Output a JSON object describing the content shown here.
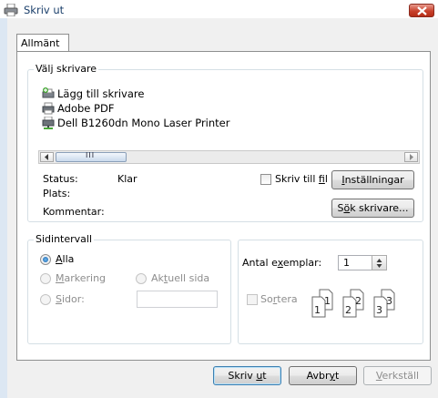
{
  "window": {
    "title": "Skriv ut",
    "close": "×"
  },
  "tabs": [
    {
      "label": "Allmänt"
    }
  ],
  "printer_group": {
    "legend": "Välj skrivare",
    "printers": [
      {
        "label": "Lägg till skrivare",
        "icon": "add-printer-icon"
      },
      {
        "label": "Adobe PDF",
        "icon": "printer-icon"
      },
      {
        "label": "Dell B1260dn Mono Laser Printer",
        "icon": "network-printer-icon"
      }
    ],
    "scroll_thumb": "III",
    "status_label": "Status:",
    "status_value": "Klar",
    "location_label": "Plats:",
    "comment_label": "Kommentar:",
    "print_to_file": {
      "pre": "Skriv till ",
      "acc": "f",
      "post": "il"
    },
    "settings_button": {
      "acc": "I",
      "post": "nställningar"
    },
    "find_printer_button": {
      "pre": "S",
      "acc": "ö",
      "post": "k skrivare..."
    }
  },
  "range_group": {
    "legend": "Sidintervall",
    "all": {
      "acc": "A",
      "post": "lla"
    },
    "selection": {
      "acc": "M",
      "post": "arkering"
    },
    "current_page": {
      "pre": "Ak",
      "acc": "t",
      "post": "uell sida"
    },
    "pages": {
      "acc": "S",
      "post": "idor:"
    },
    "pages_value": ""
  },
  "copies": {
    "label_pre": "Antal e",
    "label_acc": "x",
    "label_post": "emplar:",
    "value": "1",
    "collate": {
      "pre": "So",
      "acc": "r",
      "post": "tera"
    },
    "page_numbers": [
      "1",
      "1",
      "2",
      "2",
      "3",
      "3"
    ]
  },
  "buttons": {
    "print": {
      "pre": "Skriv ",
      "acc": "u",
      "post": "t"
    },
    "cancel": {
      "pre": "Avbr",
      "acc": "y",
      "post": "t"
    },
    "apply": {
      "acc": "V",
      "post": "erkställ"
    }
  },
  "colors": {
    "title_text": "#1b3f6b",
    "close_button": "#c8412c",
    "radio_dot": "#155fa8"
  }
}
